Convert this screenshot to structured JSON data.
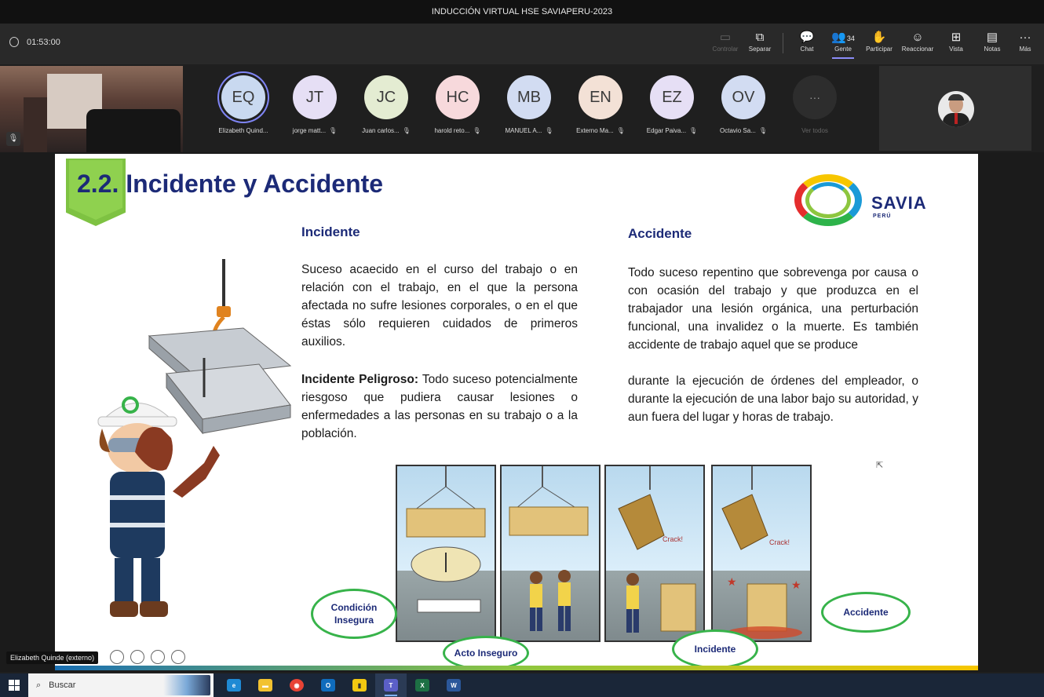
{
  "window": {
    "title": "INDUCCIÓN VIRTUAL HSE SAVIAPERU-2023"
  },
  "toolbar": {
    "timer": "01:53:00",
    "buttons": [
      {
        "label": "Controlar",
        "icon": "control-icon",
        "disabled": true
      },
      {
        "label": "Separar",
        "icon": "pop-out-icon"
      },
      {
        "label": "Chat",
        "icon": "chat-icon"
      },
      {
        "label": "Gente",
        "icon": "people-icon",
        "count": "34",
        "active": true
      },
      {
        "label": "Participar",
        "icon": "raise-hand-icon"
      },
      {
        "label": "Reaccionar",
        "icon": "reactions-icon"
      },
      {
        "label": "Vista",
        "icon": "view-icon"
      },
      {
        "label": "Notas",
        "icon": "notes-icon"
      },
      {
        "label": "Más",
        "icon": "more-icon"
      }
    ]
  },
  "participants": [
    {
      "initials": "EQ",
      "name": "Elizabeth Quind...",
      "color": "#c9d9f0",
      "speaking": true,
      "muted": false
    },
    {
      "initials": "JT",
      "name": "jorge matt...",
      "color": "#e6dff5",
      "muted": true
    },
    {
      "initials": "JC",
      "name": "Juan carlos...",
      "color": "#e4ecd2",
      "muted": true
    },
    {
      "initials": "HC",
      "name": "harold reto...",
      "color": "#f7d9dc",
      "muted": true
    },
    {
      "initials": "MB",
      "name": "MANUEL A...",
      "color": "#d2dcf2",
      "muted": true
    },
    {
      "initials": "EN",
      "name": "Externo Ma...",
      "color": "#f3e1d6",
      "muted": true
    },
    {
      "initials": "EZ",
      "name": "Edgar Paiva...",
      "color": "#e6dff5",
      "muted": true
    },
    {
      "initials": "OV",
      "name": "Octavio Sa...",
      "color": "#d2dcf2",
      "muted": true
    }
  ],
  "more_people": {
    "glyph": "···",
    "label": "Ver todos"
  },
  "slide": {
    "number": "2.2.",
    "title": "Incidente y Accidente",
    "logo": {
      "text": "SAVIA",
      "sub": "PERÚ"
    },
    "incidente": {
      "heading": "Incidente",
      "definition": "Suceso acaecido en el curso del trabajo o en relación con el trabajo, en el que la persona afectada no sufre lesiones corporales, o en el que éstas sólo requieren cuidados de primeros auxilios.",
      "peligroso_label": "Incidente Peligroso:",
      "peligroso_text": " Todo suceso potencialmente riesgoso que pudiera causar lesiones o enfermedades a las personas en su trabajo o a la población."
    },
    "accidente": {
      "heading": "Accidente",
      "definition_1": "Todo suceso repentino que sobrevenga por causa o con ocasión del trabajo y que produzca en el trabajador una lesión orgánica, una perturbación funcional, una invalidez o la muerte. Es también accidente de trabajo aquel que se produce",
      "definition_2": "durante la ejecución de órdenes del empleador, o durante la ejecución de una labor bajo su autoridad, y aun fuera del lugar y horas de trabajo."
    },
    "comic_labels": {
      "condicion": "Condición Insegura",
      "acto": "Acto Inseguro",
      "incidente": "Incidente",
      "accidente": "Accidente"
    },
    "comic_text": {
      "crack1": "Crack!",
      "crack2": "Crack!"
    }
  },
  "stage_footer": {
    "speaker_tag": "Elizabeth Quinde (externo)"
  },
  "taskbar": {
    "search_placeholder": "Buscar",
    "apps": [
      {
        "name": "edge",
        "label": "e",
        "color": "#1f8ad4"
      },
      {
        "name": "explorer",
        "label": "▬",
        "color": "#f2c230"
      },
      {
        "name": "chrome",
        "label": "◉",
        "color": "#e84335"
      },
      {
        "name": "outlook",
        "label": "O",
        "color": "#0f6cbd"
      },
      {
        "name": "powerbi",
        "label": "▮",
        "color": "#f2c811"
      },
      {
        "name": "teams",
        "label": "T",
        "color": "#5b5fc7",
        "running": true
      },
      {
        "name": "excel",
        "label": "X",
        "color": "#1d7044"
      },
      {
        "name": "word",
        "label": "W",
        "color": "#2b579a"
      }
    ]
  }
}
